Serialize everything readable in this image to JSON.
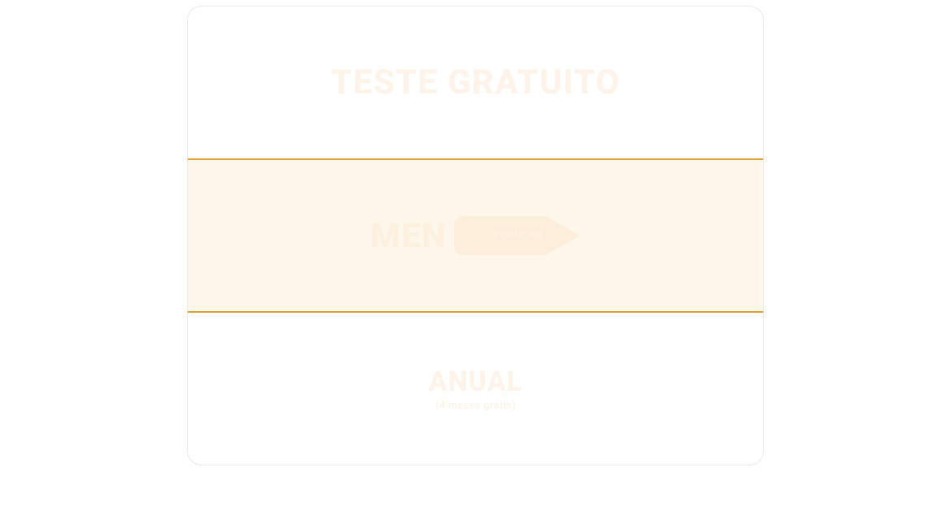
{
  "colors": {
    "accent": "#e2a336",
    "selected_bg": "#fdf6ea",
    "faded_text": "#fdf3e9"
  },
  "plans": {
    "free": {
      "label": "TESTE GRATUITO"
    },
    "monthly": {
      "label": "MEN",
      "badge": "POPULAR",
      "selected": true
    },
    "annual": {
      "label": "ANUAL",
      "sub": "(4 meses grátis)"
    }
  }
}
